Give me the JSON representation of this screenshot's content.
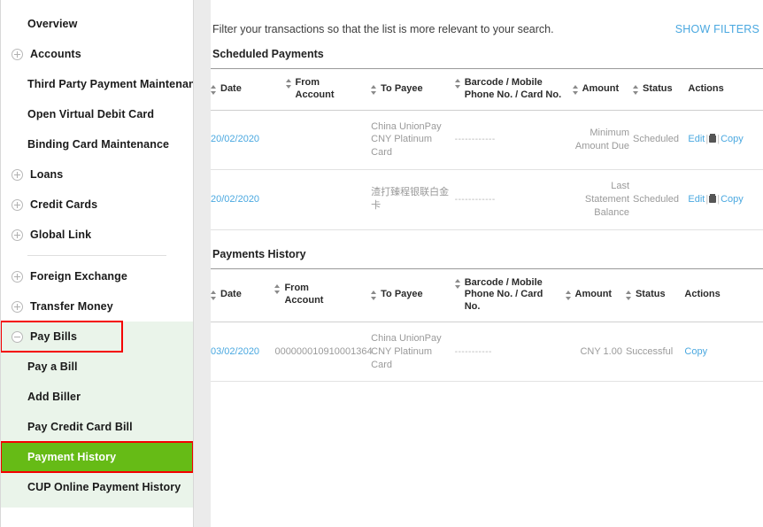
{
  "sidebar": {
    "items": [
      {
        "label": "Overview",
        "expander": "none",
        "indent": true
      },
      {
        "label": "Accounts",
        "expander": "plus",
        "indent": false
      },
      {
        "label": "Third Party Payment Maintenance",
        "expander": "none",
        "indent": true
      },
      {
        "label": "Open Virtual Debit Card",
        "expander": "none",
        "indent": true
      },
      {
        "label": "Binding Card Maintenance",
        "expander": "none",
        "indent": true
      },
      {
        "label": "Loans",
        "expander": "plus",
        "indent": false
      },
      {
        "label": "Credit Cards",
        "expander": "plus",
        "indent": false
      },
      {
        "label": "Global Link",
        "expander": "plus",
        "indent": false
      },
      {
        "label": "Foreign Exchange",
        "expander": "plus",
        "indent": false
      },
      {
        "label": "Transfer Money",
        "expander": "plus",
        "indent": false
      },
      {
        "label": "Pay Bills",
        "expander": "minus",
        "indent": false
      },
      {
        "label": "Pay a Bill",
        "expander": "none",
        "indent": true
      },
      {
        "label": "Add Biller",
        "expander": "none",
        "indent": true
      },
      {
        "label": "Pay Credit Card Bill",
        "expander": "none",
        "indent": true
      },
      {
        "label": "Payment History",
        "expander": "none",
        "indent": true
      },
      {
        "label": "CUP Online Payment History",
        "expander": "none",
        "indent": true
      }
    ],
    "highlight_color": "#f40000",
    "active_color": "#66bb16",
    "group_bg": "#eaf4ea"
  },
  "main": {
    "filter_text": "Filter your transactions so that the list is more relevant to your search.",
    "show_filters_label": "SHOW FILTERS",
    "link_color": "#4aa8e0",
    "scheduled": {
      "title": "Scheduled Payments",
      "columns": [
        {
          "label": "Date",
          "sortable": true
        },
        {
          "label": "From Account",
          "sortable": true
        },
        {
          "label": "To Payee",
          "sortable": true
        },
        {
          "label": "Barcode / Mobile Phone No. / Card No.",
          "sortable": true
        },
        {
          "label": "Amount",
          "sortable": true
        },
        {
          "label": "Status",
          "sortable": true
        },
        {
          "label": "Actions",
          "sortable": false
        }
      ],
      "rows": [
        {
          "date": "20/02/2020",
          "from_account": "",
          "to_payee": "China UnionPay CNY Platinum Card",
          "barcode": "------------",
          "amount": "Minimum Amount Due",
          "status": "Scheduled",
          "edit_label": "Edit",
          "delete_icon": "trash-icon",
          "copy_label": "Copy"
        },
        {
          "date": "20/02/2020",
          "from_account": "",
          "to_payee": "渣打臻程银联白金卡",
          "barcode": "------------",
          "amount": "Last Statement Balance",
          "status": "Scheduled",
          "edit_label": "Edit",
          "delete_icon": "trash-icon",
          "copy_label": "Copy"
        }
      ]
    },
    "history": {
      "title": "Payments History",
      "columns": [
        {
          "label": "Date",
          "sortable": true
        },
        {
          "label": "From Account",
          "sortable": true
        },
        {
          "label": "To Payee",
          "sortable": true
        },
        {
          "label": "Barcode / Mobile Phone No. / Card No.",
          "sortable": true
        },
        {
          "label": "Amount",
          "sortable": true
        },
        {
          "label": "Status",
          "sortable": true
        },
        {
          "label": "Actions",
          "sortable": false
        }
      ],
      "rows": [
        {
          "date": "03/02/2020",
          "from_account": "000000010910001364",
          "to_payee": "China UnionPay CNY Platinum Card",
          "barcode": "-----------",
          "amount": "CNY 1.00",
          "status": "Successful",
          "copy_label": "Copy"
        }
      ]
    }
  }
}
